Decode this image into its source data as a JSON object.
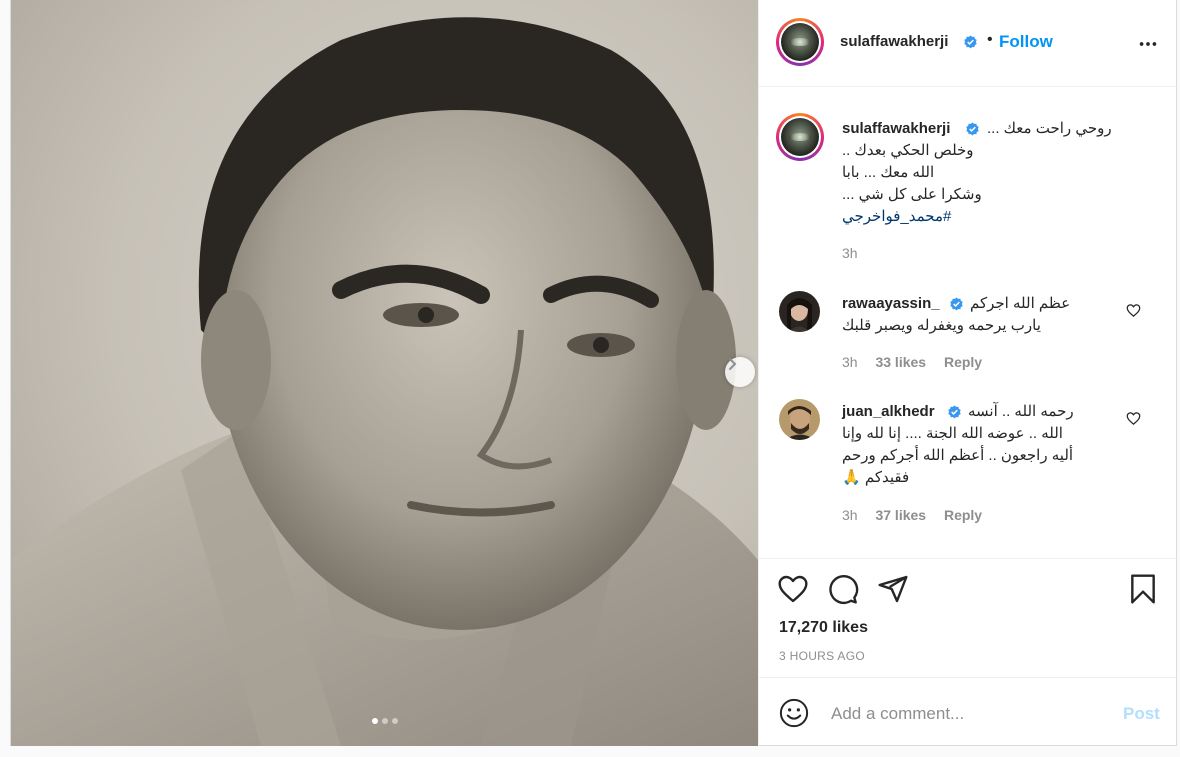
{
  "post": {
    "username": "sulaffawakherji",
    "follow_label": "Follow",
    "bullet": "•",
    "more_icon": "more-horizontal-icon"
  },
  "caption": {
    "username": "sulaffawakherji",
    "lines": [
      "روحي راحت معك ...",
      "وخلص الحكي بعدك ..",
      "الله معك ... بابا",
      "وشكرا على كل شي ...",
      "#محمد_فواخرجي"
    ],
    "time": "3h"
  },
  "comments": [
    {
      "username": "rawaayassin_",
      "lines": [
        "عظم الله اجركم",
        "يارب يرحمه ويغفرله ويصبر قلبك"
      ],
      "time": "3h",
      "likes": "33 likes",
      "reply": "Reply"
    },
    {
      "username": "juan_alkhedr",
      "lines": [
        "رحمه الله .. آنسه",
        "الله .. عوضه الله الجنة .... إنا لله وإنا",
        "أليه راجعون .. أعظم الله أجركم ورحم",
        "فقيدكم 🙏"
      ],
      "time": "3h",
      "likes": "37 likes",
      "reply": "Reply"
    }
  ],
  "likes_count": "17,270 likes",
  "timestamp": "3 HOURS AGO",
  "comment_input": {
    "placeholder": "Add a comment...",
    "post_label": "Post"
  },
  "carousel": {
    "slides": 3,
    "active": 0
  },
  "colors": {
    "accent": "#0095f6",
    "text": "#262626",
    "muted": "#8e8e8e",
    "hashtag": "#00376b",
    "post_disabled": "#b2dffc"
  }
}
